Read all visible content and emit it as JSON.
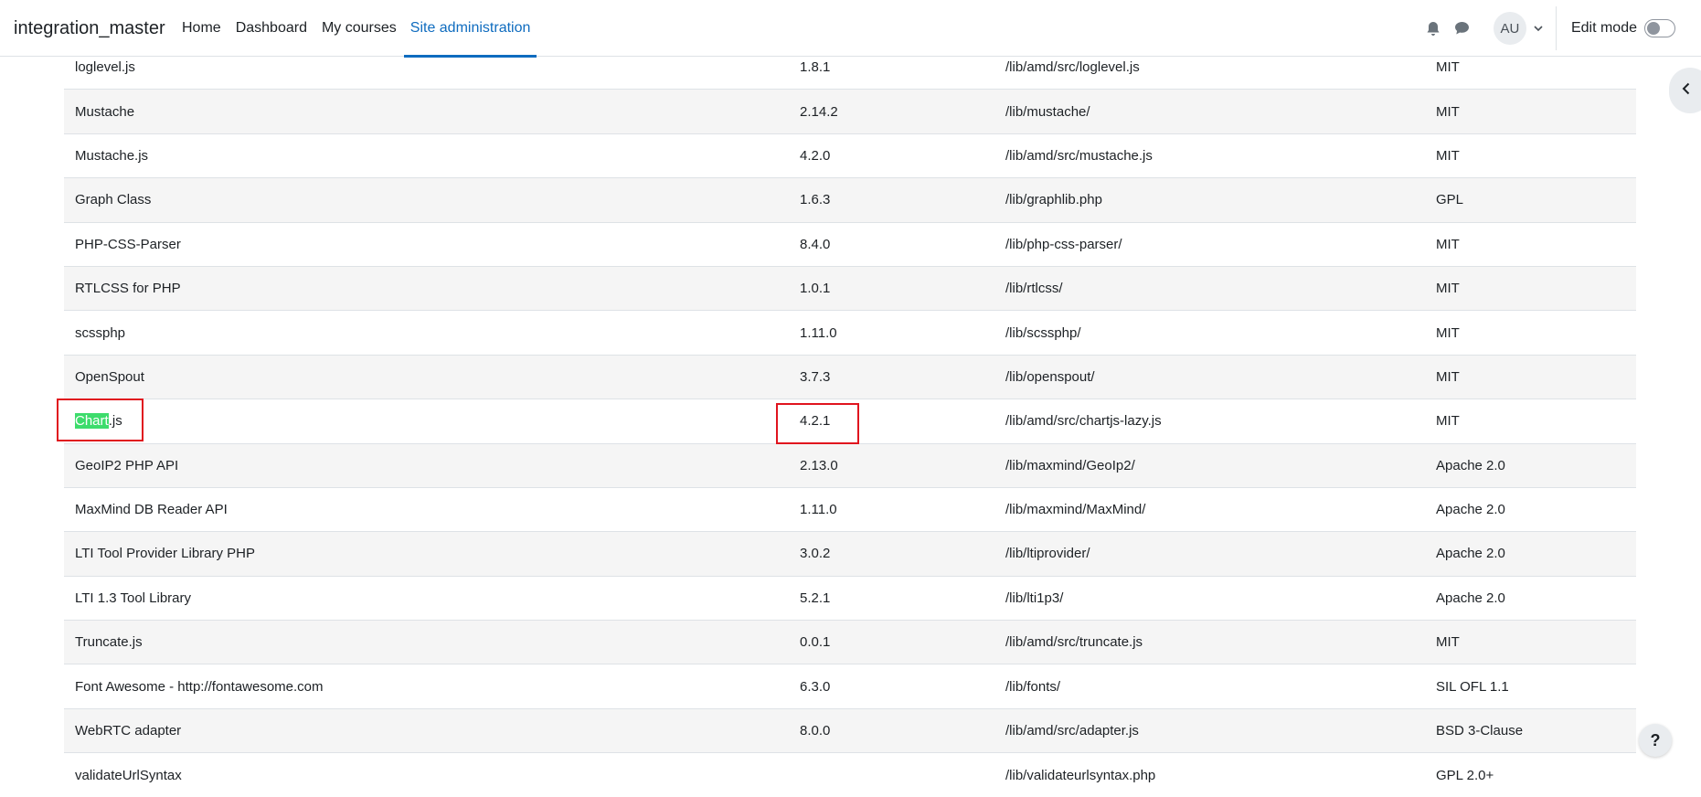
{
  "navbar": {
    "brand": "integration_master",
    "links": [
      "Home",
      "Dashboard",
      "My courses",
      "Site administration"
    ],
    "avatar_initials": "AU",
    "edit_mode_label": "Edit mode"
  },
  "libraries": [
    {
      "name": "loglevel.js",
      "version": "1.8.1",
      "location": "/lib/amd/src/loglevel.js",
      "license": "MIT"
    },
    {
      "name": "Mustache",
      "version": "2.14.2",
      "location": "/lib/mustache/",
      "license": "MIT"
    },
    {
      "name": "Mustache.js",
      "version": "4.2.0",
      "location": "/lib/amd/src/mustache.js",
      "license": "MIT"
    },
    {
      "name": "Graph Class",
      "version": "1.6.3",
      "location": "/lib/graphlib.php",
      "license": "GPL"
    },
    {
      "name": "PHP-CSS-Parser",
      "version": "8.4.0",
      "location": "/lib/php-css-parser/",
      "license": "MIT"
    },
    {
      "name": "RTLCSS for PHP",
      "version": "1.0.1",
      "location": "/lib/rtlcss/",
      "license": "MIT"
    },
    {
      "name": "scssphp",
      "version": "1.11.0",
      "location": "/lib/scssphp/",
      "license": "MIT"
    },
    {
      "name": "OpenSpout",
      "version": "3.7.3",
      "location": "/lib/openspout/",
      "license": "MIT"
    },
    {
      "name_highlight": "Chart",
      "name_rest": ".js",
      "version": "4.2.1",
      "location": "/lib/amd/src/chartjs-lazy.js",
      "license": "MIT"
    },
    {
      "name": "GeoIP2 PHP API",
      "version": "2.13.0",
      "location": "/lib/maxmind/GeoIp2/",
      "license": "Apache 2.0"
    },
    {
      "name": "MaxMind DB Reader API",
      "version": "1.11.0",
      "location": "/lib/maxmind/MaxMind/",
      "license": "Apache 2.0"
    },
    {
      "name": "LTI Tool Provider Library PHP",
      "version": "3.0.2",
      "location": "/lib/ltiprovider/",
      "license": "Apache 2.0"
    },
    {
      "name": "LTI 1.3 Tool Library",
      "version": "5.2.1",
      "location": "/lib/lti1p3/",
      "license": "Apache 2.0"
    },
    {
      "name": "Truncate.js",
      "version": "0.0.1",
      "location": "/lib/amd/src/truncate.js",
      "license": "MIT"
    },
    {
      "name": "Font Awesome - http://fontawesome.com",
      "version": "6.3.0",
      "location": "/lib/fonts/",
      "license": "SIL OFL 1.1"
    },
    {
      "name": "WebRTC adapter",
      "version": "8.0.0",
      "location": "/lib/amd/src/adapter.js",
      "license": "BSD 3-Clause"
    },
    {
      "name": "validateUrlSyntax",
      "version": "",
      "location": "/lib/validateurlsyntax.php",
      "license": "GPL 2.0+"
    }
  ],
  "help_label": "?",
  "colors": {
    "accent": "#0f6cbf",
    "highlight": "#3ddc6c",
    "annotation": "#e0141e"
  }
}
